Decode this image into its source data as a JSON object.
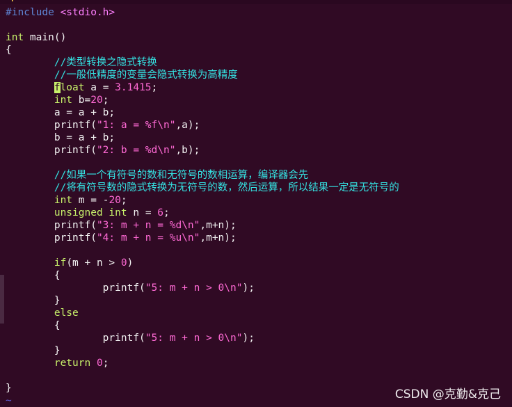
{
  "editor": {
    "top_strip_text": "~:-----------------------------------------------------",
    "lines": [
      {
        "id": 1,
        "parts": [
          {
            "cls": "pp",
            "text": "#include "
          },
          {
            "cls": "inc",
            "text": "<stdio.h>"
          }
        ]
      },
      {
        "id": 2,
        "parts": []
      },
      {
        "id": 3,
        "parts": [
          {
            "cls": "kw",
            "text": "int"
          },
          {
            "cls": "br",
            "text": " main()"
          }
        ]
      },
      {
        "id": 4,
        "parts": [
          {
            "cls": "br",
            "text": "{"
          }
        ]
      },
      {
        "id": 5,
        "parts": [
          {
            "cls": "br",
            "text": "        "
          },
          {
            "cls": "cm",
            "text": "//类型转换之隐式转换"
          }
        ]
      },
      {
        "id": 6,
        "parts": [
          {
            "cls": "br",
            "text": "        "
          },
          {
            "cls": "cm",
            "text": "//一般低精度的变量会隐式转换为高精度"
          }
        ]
      },
      {
        "id": 7,
        "parts": [
          {
            "cls": "br",
            "text": "        "
          },
          {
            "cls": "cursor",
            "text": "f"
          },
          {
            "cls": "kw",
            "text": "loat"
          },
          {
            "cls": "br",
            "text": " a = "
          },
          {
            "cls": "num",
            "text": "3.1415"
          },
          {
            "cls": "br",
            "text": ";"
          }
        ]
      },
      {
        "id": 8,
        "parts": [
          {
            "cls": "br",
            "text": "        "
          },
          {
            "cls": "kw",
            "text": "int"
          },
          {
            "cls": "br",
            "text": " b="
          },
          {
            "cls": "num",
            "text": "20"
          },
          {
            "cls": "br",
            "text": ";"
          }
        ]
      },
      {
        "id": 9,
        "parts": [
          {
            "cls": "br",
            "text": "        a = a + b;"
          }
        ]
      },
      {
        "id": 10,
        "parts": [
          {
            "cls": "br",
            "text": "        printf("
          },
          {
            "cls": "st",
            "text": "\"1: a = %f\\n\""
          },
          {
            "cls": "br",
            "text": ",a);"
          }
        ]
      },
      {
        "id": 11,
        "parts": [
          {
            "cls": "br",
            "text": "        b = a + b;"
          }
        ]
      },
      {
        "id": 12,
        "parts": [
          {
            "cls": "br",
            "text": "        printf("
          },
          {
            "cls": "st",
            "text": "\"2: b = %d\\n\""
          },
          {
            "cls": "br",
            "text": ",b);"
          }
        ]
      },
      {
        "id": 13,
        "parts": []
      },
      {
        "id": 14,
        "parts": [
          {
            "cls": "br",
            "text": "        "
          },
          {
            "cls": "cm",
            "text": "//如果一个有符号的数和无符号的数相运算，编译器会先"
          }
        ]
      },
      {
        "id": 15,
        "parts": [
          {
            "cls": "br",
            "text": "        "
          },
          {
            "cls": "cm",
            "text": "//将有符号数的隐式转换为无符号的数，然后运算，所以结果一定是无符号的"
          }
        ]
      },
      {
        "id": 16,
        "parts": [
          {
            "cls": "br",
            "text": "        "
          },
          {
            "cls": "kw",
            "text": "int"
          },
          {
            "cls": "br",
            "text": " m = -"
          },
          {
            "cls": "num",
            "text": "20"
          },
          {
            "cls": "br",
            "text": ";"
          }
        ]
      },
      {
        "id": 17,
        "parts": [
          {
            "cls": "br",
            "text": "        "
          },
          {
            "cls": "kw",
            "text": "unsigned"
          },
          {
            "cls": "br",
            "text": " "
          },
          {
            "cls": "kw",
            "text": "int"
          },
          {
            "cls": "br",
            "text": " n = "
          },
          {
            "cls": "num",
            "text": "6"
          },
          {
            "cls": "br",
            "text": ";"
          }
        ]
      },
      {
        "id": 18,
        "parts": [
          {
            "cls": "br",
            "text": "        printf("
          },
          {
            "cls": "st",
            "text": "\"3: m + n = %d\\n\""
          },
          {
            "cls": "br",
            "text": ",m+n);"
          }
        ]
      },
      {
        "id": 19,
        "parts": [
          {
            "cls": "br",
            "text": "        printf("
          },
          {
            "cls": "st",
            "text": "\"4: m + n = %u\\n\""
          },
          {
            "cls": "br",
            "text": ",m+n);"
          }
        ]
      },
      {
        "id": 20,
        "parts": []
      },
      {
        "id": 21,
        "parts": [
          {
            "cls": "br",
            "text": "        "
          },
          {
            "cls": "kw",
            "text": "if"
          },
          {
            "cls": "br",
            "text": "(m + n > "
          },
          {
            "cls": "num",
            "text": "0"
          },
          {
            "cls": "br",
            "text": ")"
          }
        ]
      },
      {
        "id": 22,
        "parts": [
          {
            "cls": "br",
            "text": "        {"
          }
        ]
      },
      {
        "id": 23,
        "parts": [
          {
            "cls": "br",
            "text": "                printf("
          },
          {
            "cls": "st",
            "text": "\"5: m + n > 0\\n\""
          },
          {
            "cls": "br",
            "text": ");"
          }
        ]
      },
      {
        "id": 24,
        "parts": [
          {
            "cls": "br",
            "text": "        }"
          }
        ]
      },
      {
        "id": 25,
        "parts": [
          {
            "cls": "br",
            "text": "        "
          },
          {
            "cls": "kw",
            "text": "else"
          }
        ]
      },
      {
        "id": 26,
        "parts": [
          {
            "cls": "br",
            "text": "        {"
          }
        ]
      },
      {
        "id": 27,
        "parts": [
          {
            "cls": "br",
            "text": "                printf("
          },
          {
            "cls": "st",
            "text": "\"5: m + n > 0\\n\""
          },
          {
            "cls": "br",
            "text": ");"
          }
        ]
      },
      {
        "id": 28,
        "parts": [
          {
            "cls": "br",
            "text": "        }"
          }
        ]
      },
      {
        "id": 29,
        "parts": [
          {
            "cls": "br",
            "text": "        "
          },
          {
            "cls": "kw",
            "text": "return"
          },
          {
            "cls": "br",
            "text": " "
          },
          {
            "cls": "num",
            "text": "0"
          },
          {
            "cls": "br",
            "text": ";"
          }
        ]
      },
      {
        "id": 30,
        "parts": []
      },
      {
        "id": 31,
        "parts": [
          {
            "cls": "br",
            "text": "}"
          }
        ]
      },
      {
        "id": 32,
        "parts": [
          {
            "cls": "tilde",
            "text": "~"
          }
        ]
      }
    ]
  },
  "watermark": "CSDN @克勤&克己",
  "colors": {
    "background": "#300a24",
    "keyword": "#c7f06a",
    "comment": "#34e2e2",
    "string": "#ff6ad5",
    "preprocessor": "#5f87d7"
  }
}
